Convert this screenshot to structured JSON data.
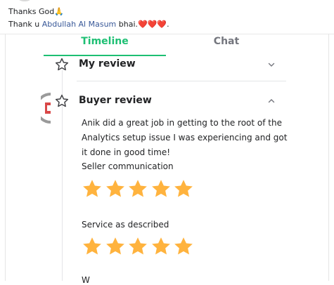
{
  "post": {
    "line1_text": "Thanks God",
    "line1_emoji": "🙏",
    "line2_prefix": "Thank u ",
    "mention": "Abdullah Al Masum",
    "line2_suffix": " bhai.",
    "hearts": "❤️❤️❤️",
    "line2_end": "."
  },
  "tabs": {
    "timeline": "Timeline",
    "chat": "Chat",
    "active": "timeline"
  },
  "my_review": {
    "title": "My review",
    "expanded": false
  },
  "buyer_review": {
    "title": "Buyer review",
    "expanded": true,
    "text": "Anik did a great job in getting to the root of the Analytics setup issue I was experiencing and got it done in good time!",
    "ratings": [
      {
        "label": "Seller communication",
        "stars": 5
      },
      {
        "label": "Service as described",
        "stars": 5
      }
    ],
    "next_label_partial": "W"
  },
  "colors": {
    "accent_green": "#1dbf73",
    "star_gold": "#ffb33e",
    "mention_blue": "#385898",
    "heart_red": "#e0245e"
  }
}
